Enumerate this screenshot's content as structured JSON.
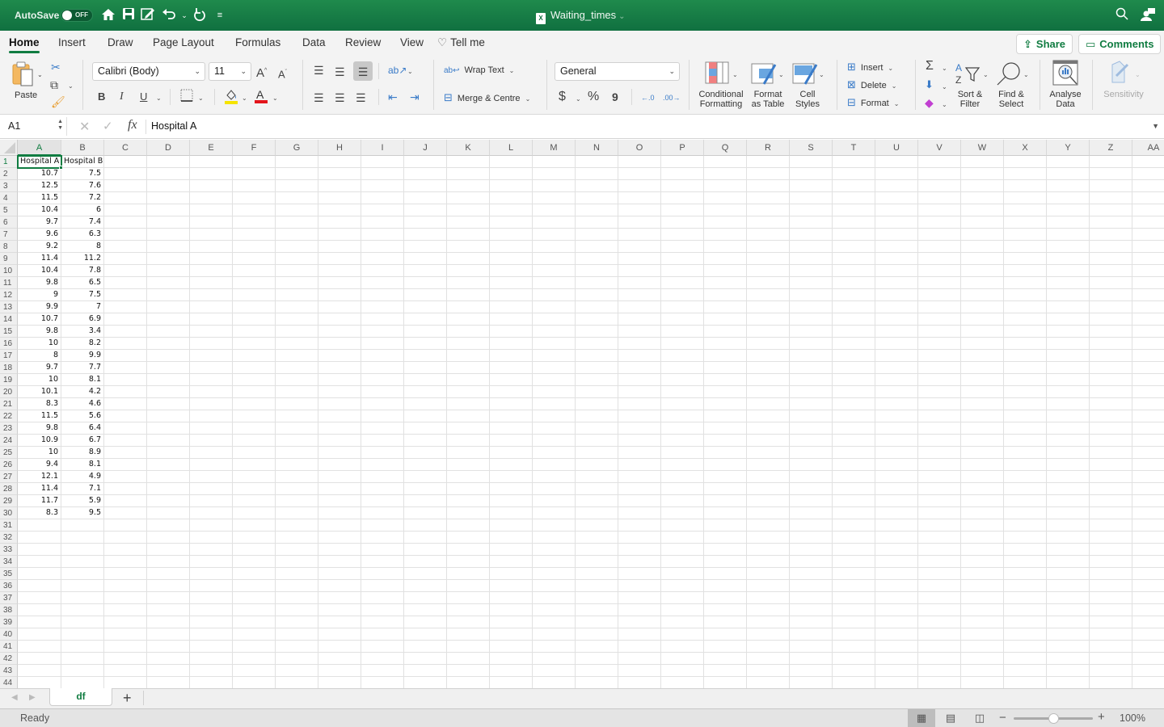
{
  "titlebar": {
    "autosave_label": "AutoSave",
    "autosave_state": "OFF",
    "doc_title": "Waiting_times",
    "icons": [
      "home-icon",
      "save-icon",
      "edit-icon",
      "undo-icon",
      "redo-icon",
      "customize-icon",
      "search-icon",
      "share-person-icon"
    ]
  },
  "tabs": [
    {
      "label": "Home",
      "active": true
    },
    {
      "label": "Insert"
    },
    {
      "label": "Draw"
    },
    {
      "label": "Page Layout"
    },
    {
      "label": "Formulas"
    },
    {
      "label": "Data"
    },
    {
      "label": "Review"
    },
    {
      "label": "View"
    },
    {
      "label": "Tell me"
    }
  ],
  "share_label": "Share",
  "comments_label": "Comments",
  "ribbon": {
    "paste_label": "Paste",
    "font_name": "Calibri (Body)",
    "font_size": "11",
    "bold": "B",
    "italic": "I",
    "underline": "U",
    "wrap_text": "Wrap Text",
    "merge_centre": "Merge & Centre",
    "number_format": "General",
    "currency": "$",
    "percent": "%",
    "comma": "9",
    "conditional_formatting": [
      "Conditional",
      "Formatting"
    ],
    "format_as_table": [
      "Format",
      "as Table"
    ],
    "cell_styles": [
      "Cell",
      "Styles"
    ],
    "insert": "Insert",
    "delete": "Delete",
    "format": "Format",
    "sort_filter": [
      "Sort &",
      "Filter"
    ],
    "find_select": [
      "Find &",
      "Select"
    ],
    "analyse_data": [
      "Analyse",
      "Data"
    ],
    "sensitivity": "Sensitivity",
    "fill_color": "#f5e400",
    "font_color": "#e3141b"
  },
  "formula_bar": {
    "name_box": "A1",
    "fx": "fx",
    "content": "Hospital A"
  },
  "columns": [
    "A",
    "B",
    "C",
    "D",
    "E",
    "F",
    "G",
    "H",
    "I",
    "J",
    "K",
    "L",
    "M",
    "N",
    "O",
    "P",
    "Q",
    "R",
    "S",
    "T",
    "U",
    "V",
    "W",
    "X",
    "Y",
    "Z",
    "AA"
  ],
  "selected_column": "A",
  "selected_row": 1,
  "visible_rows": 44,
  "sheet": {
    "headers": [
      "Hospital A",
      "Hospital B"
    ],
    "rows": [
      [
        "10.7",
        "7.5"
      ],
      [
        "12.5",
        "7.6"
      ],
      [
        "11.5",
        "7.2"
      ],
      [
        "10.4",
        "6"
      ],
      [
        "9.7",
        "7.4"
      ],
      [
        "9.6",
        "6.3"
      ],
      [
        "9.2",
        "8"
      ],
      [
        "11.4",
        "11.2"
      ],
      [
        "10.4",
        "7.8"
      ],
      [
        "9.8",
        "6.5"
      ],
      [
        "9",
        "7.5"
      ],
      [
        "9.9",
        "7"
      ],
      [
        "10.7",
        "6.9"
      ],
      [
        "9.8",
        "3.4"
      ],
      [
        "10",
        "8.2"
      ],
      [
        "8",
        "9.9"
      ],
      [
        "9.7",
        "7.7"
      ],
      [
        "10",
        "8.1"
      ],
      [
        "10.1",
        "4.2"
      ],
      [
        "8.3",
        "4.6"
      ],
      [
        "11.5",
        "5.6"
      ],
      [
        "9.8",
        "6.4"
      ],
      [
        "10.9",
        "6.7"
      ],
      [
        "10",
        "8.9"
      ],
      [
        "9.4",
        "8.1"
      ],
      [
        "12.1",
        "4.9"
      ],
      [
        "11.4",
        "7.1"
      ],
      [
        "11.7",
        "5.9"
      ],
      [
        "8.3",
        "9.5"
      ]
    ]
  },
  "sheet_tabs": [
    {
      "label": "df",
      "active": true
    }
  ],
  "add_sheet": "+",
  "status": {
    "text": "Ready",
    "zoom": "100%",
    "zoom_percent": 100
  }
}
